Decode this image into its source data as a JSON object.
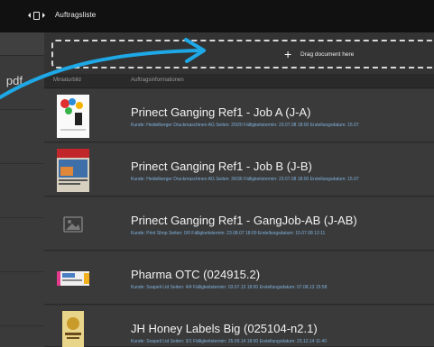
{
  "window": {
    "title": "Auftragsliste"
  },
  "sidebar": {
    "file_label": "pdf"
  },
  "dropzone": {
    "label": "Drag document here"
  },
  "columns": {
    "thumbnail": "Miniaturbild",
    "info": "Auftragsinformationen"
  },
  "jobs": [
    {
      "name": "Prinect Ganging Ref1 - Job A (J-A)",
      "meta": "Kunde: Heidelberger Druckmaschinen AG Seiten: 20/20 Fälligkeitstermin: 23.07.08 18:00 Erstellungsdatum: 15.07"
    },
    {
      "name": "Prinect Ganging Ref1 - Job B (J-B)",
      "meta": "Kunde: Heidelberger Druckmaschinen AG Seiten: 36/36 Fälligkeitstermin: 23.07.08 18:00 Erstellungsdatum: 15.07"
    },
    {
      "name": "Prinect Ganging Ref1 - GangJob-AB (J-AB)",
      "meta": "Kunde: Print Shop Seiten: 0/0 Fälligkeitstermin: 23.08.07 18:00 Erstellungsdatum: 15.07.08 12:11"
    },
    {
      "name": "Pharma OTC (024915.2)",
      "meta": "Kunde: Soapeli Ltd Seiten: 4/4 Fälligkeitstermin: 03.07.13 18:00 Erstellungsdatum: 07.08.13 15:58"
    },
    {
      "name": "JH Honey Labels Big (025104-n2.1)",
      "meta": "Kunde: Soapeli Ltd Seiten: 3/1 Fälligkeitstermin: 25.09.14 18:00 Erstellungsdatum: 23.12.14 11:40"
    }
  ],
  "colors": {
    "accent_arrow": "#1ea8e6",
    "meta_text": "#7fb2de"
  },
  "icons": {
    "sidebar_toggle": "panel-toggle-icon",
    "add": "plus-icon",
    "placeholder": "image-placeholder-icon"
  }
}
